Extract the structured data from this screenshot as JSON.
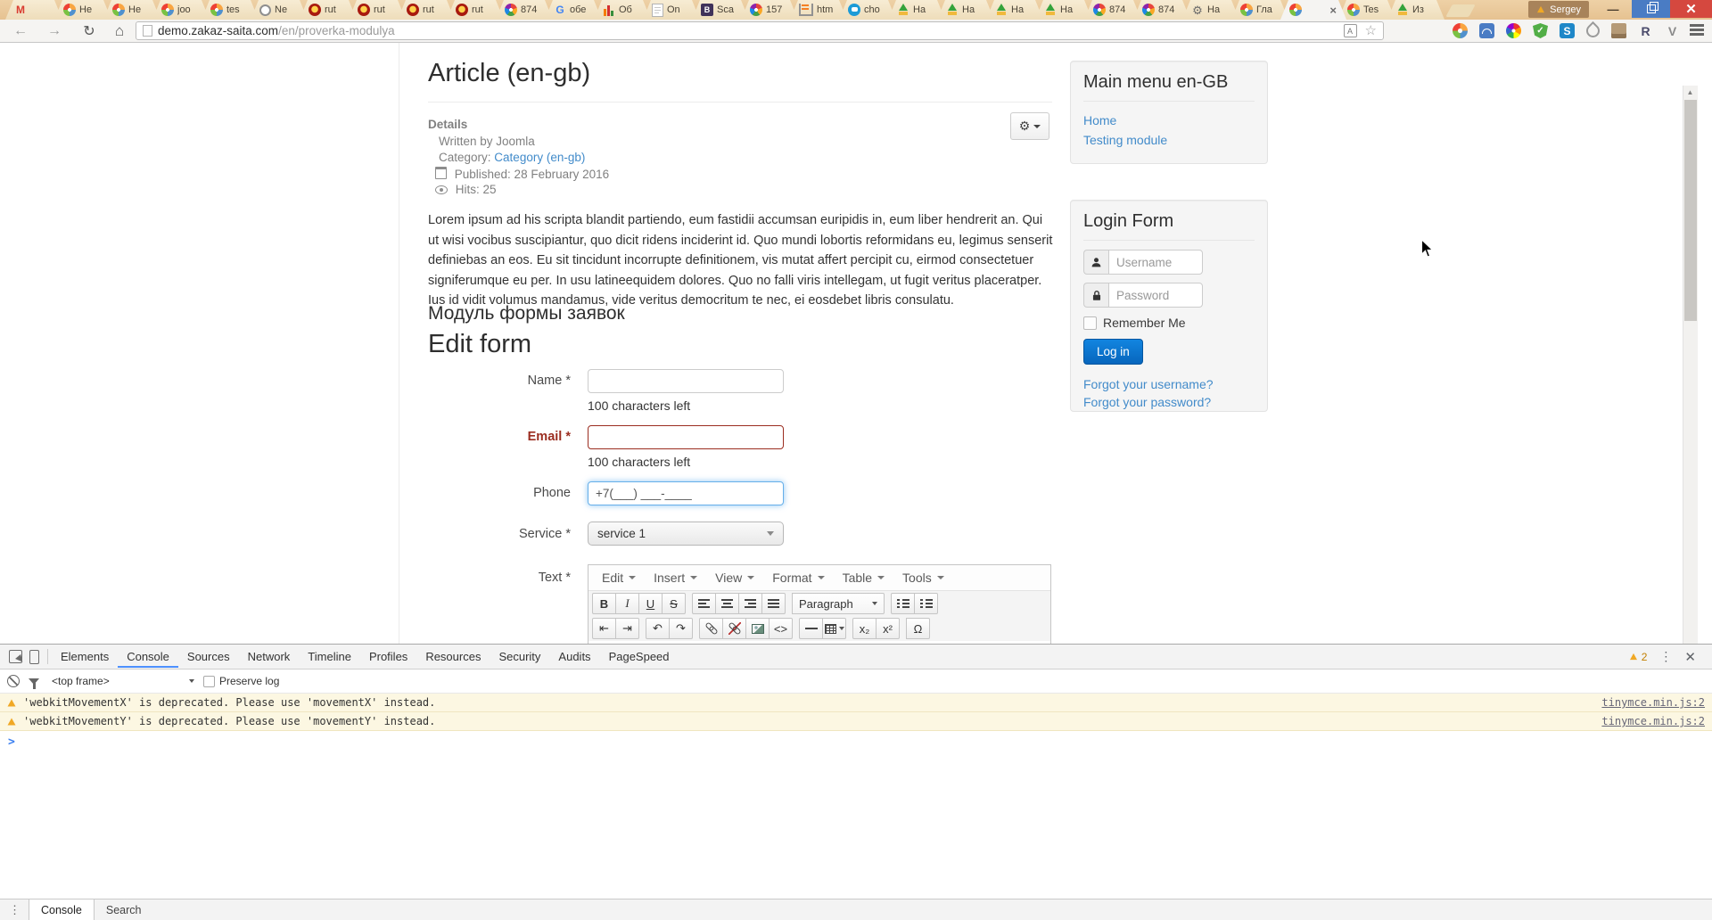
{
  "browser": {
    "profile_name": "Sergey",
    "url": {
      "host": "demo.zakaz-saita.com",
      "path": "/en/proverka-modulya"
    },
    "tabs": [
      {
        "icon": "gmail",
        "label": ""
      },
      {
        "icon": "joomla",
        "label": "He"
      },
      {
        "icon": "joomla",
        "label": "He"
      },
      {
        "icon": "joomla",
        "label": "joo"
      },
      {
        "icon": "joomla",
        "label": "tes"
      },
      {
        "icon": "ring",
        "label": "Ne"
      },
      {
        "icon": "rut",
        "label": "rut"
      },
      {
        "icon": "rut",
        "label": "rut"
      },
      {
        "icon": "rut",
        "label": "rut"
      },
      {
        "icon": "rut",
        "label": "rut"
      },
      {
        "icon": "pin",
        "label": "874"
      },
      {
        "icon": "google",
        "label": "обе"
      },
      {
        "icon": "chart",
        "label": "Об"
      },
      {
        "icon": "doc",
        "label": "On"
      },
      {
        "icon": "bsq",
        "label": "Sca"
      },
      {
        "icon": "pin",
        "label": "157"
      },
      {
        "icon": "so",
        "label": "htm"
      },
      {
        "icon": "bubble",
        "label": "cho"
      },
      {
        "icon": "up",
        "label": "На"
      },
      {
        "icon": "up",
        "label": "На"
      },
      {
        "icon": "up",
        "label": "На"
      },
      {
        "icon": "up",
        "label": "На"
      },
      {
        "icon": "pin",
        "label": "874"
      },
      {
        "icon": "pin",
        "label": "874"
      },
      {
        "icon": "gear",
        "label": "На"
      },
      {
        "icon": "joomla",
        "label": "Гла"
      },
      {
        "icon": "joomla",
        "label": "",
        "active": true,
        "close": true
      },
      {
        "icon": "joomla",
        "label": "Tes"
      },
      {
        "icon": "up",
        "label": "Из"
      }
    ],
    "extensions": [
      "joomla-ext",
      "speed-dial-ext",
      "color-wheel-ext",
      "shield-ext",
      "s-ext",
      "drop-ext",
      "package-ext",
      "roboform-ext",
      "v-ext"
    ]
  },
  "page": {
    "article": {
      "title": "Article (en-gb)",
      "details_heading": "Details",
      "written_by": "Written by Joomla",
      "category_label": "Category:",
      "category_link": "Category (en-gb)",
      "published": "Published: 28 February 2016",
      "hits": "Hits: 25"
    },
    "body_text": "Lorem ipsum ad his scripta blandit partiendo, eum fastidii accumsan euripidis in, eum liber hendrerit an. Qui ut wisi vocibus suscipiantur, quo dicit ridens inciderint id. Quo mundi lobortis reformidans eu, legimus senserit definiebas an eos. Eu sit tincidunt incorrupte definitionem, vis mutat affert percipit cu, eirmod consectetuer signiferumque eu per. In usu latineequidem dolores. Quo no falli viris intellegam, ut fugit veritus placeratper. Ius id vidit volumus mandamus, vide veritus democritum te nec, ei eosdebet libris consulatu.",
    "module_heading": "Модуль формы заявок",
    "form_heading": "Edit form",
    "form": {
      "name_label": "Name *",
      "name_counter": "100 characters left",
      "email_label": "Email *",
      "email_counter": "100 characters left",
      "phone_label": "Phone",
      "phone_value": "+7(___) ___-____",
      "service_label": "Service *",
      "service_value": "service 1",
      "text_label": "Text *",
      "editor_menus": [
        "Edit",
        "Insert",
        "View",
        "Format",
        "Table",
        "Tools"
      ],
      "paragraph_label": "Paragraph",
      "toolbar_row1": [
        [
          "bold",
          "italic",
          "underline",
          "strikethrough"
        ],
        [
          "align-left",
          "align-center",
          "align-right",
          "align-justify"
        ],
        [
          "paragraph"
        ],
        [
          "bullet-list",
          "numbered-list"
        ]
      ],
      "toolbar_row2": [
        [
          "outdent",
          "indent"
        ],
        [
          "undo",
          "redo"
        ],
        [
          "link",
          "unlink",
          "image",
          "source-code"
        ],
        [
          "horizontal-rule",
          "table"
        ],
        [
          "subscript",
          "superscript"
        ],
        [
          "special-character"
        ]
      ]
    },
    "sidebar": {
      "menu_title": "Main menu en-GB",
      "menu_links": [
        "Home",
        "Testing module"
      ],
      "login_title": "Login Form",
      "username_placeholder": "Username",
      "password_placeholder": "Password",
      "remember_label": "Remember Me",
      "login_button": "Log in",
      "forgot_links": [
        "Forgot your username?",
        "Forgot your password?"
      ]
    }
  },
  "devtools": {
    "tabs": [
      "Elements",
      "Console",
      "Sources",
      "Network",
      "Timeline",
      "Profiles",
      "Resources",
      "Security",
      "Audits",
      "PageSpeed"
    ],
    "active_tab": "Console",
    "frame_selector": "<top frame>",
    "preserve_log_label": "Preserve log",
    "warning_count": "2",
    "messages": [
      {
        "text": "'webkitMovementX' is deprecated. Please use 'movementX' instead.",
        "source": "tinymce.min.js:2"
      },
      {
        "text": "'webkitMovementY' is deprecated. Please use 'movementY' instead.",
        "source": "tinymce.min.js:2"
      }
    ],
    "drawer_tabs": [
      "Console",
      "Search"
    ],
    "drawer_active": "Console"
  }
}
